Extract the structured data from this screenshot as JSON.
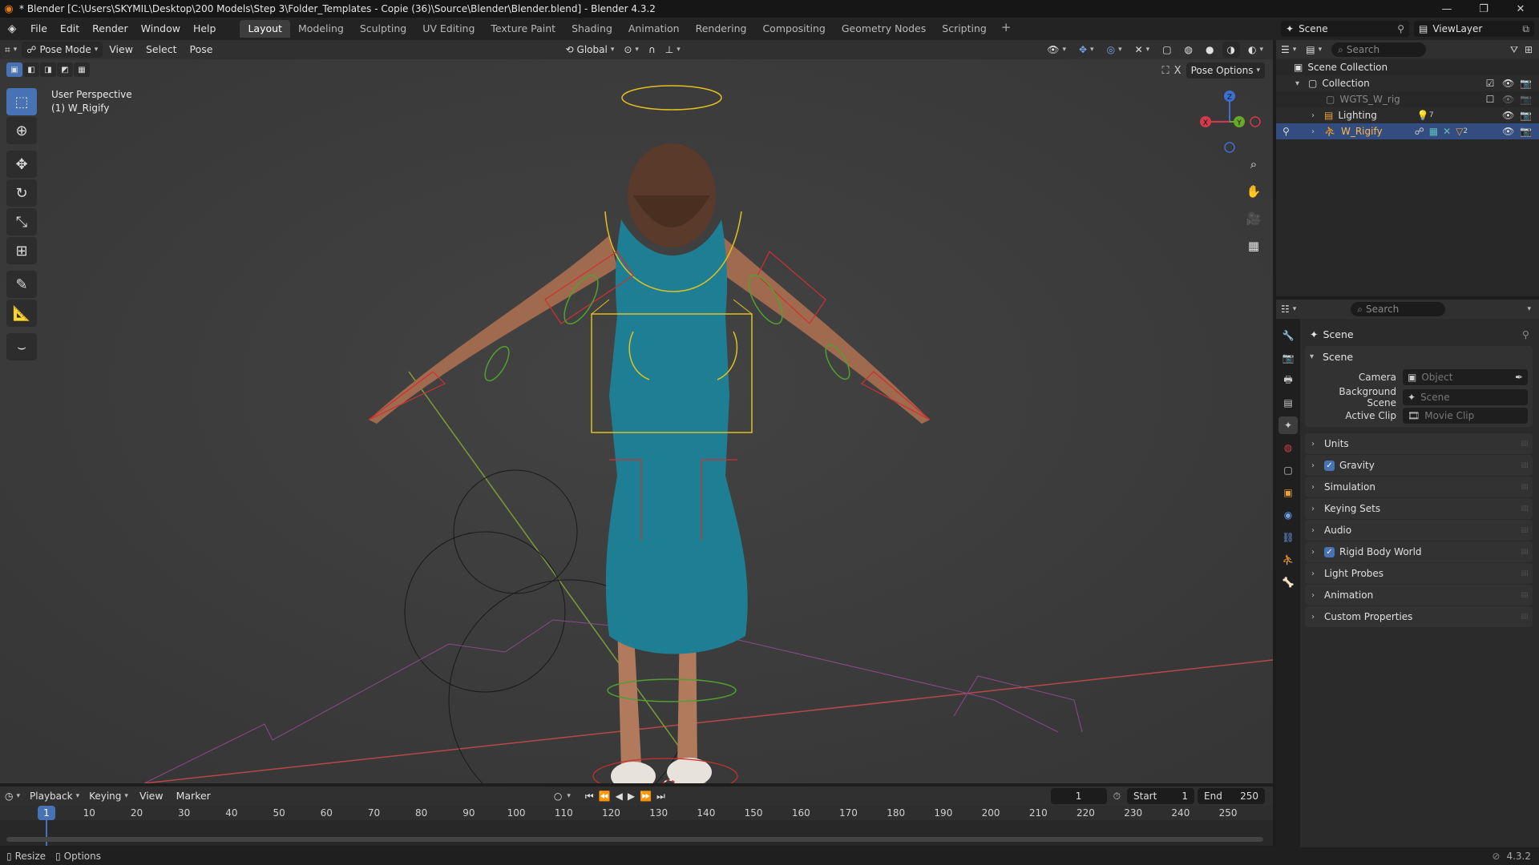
{
  "window": {
    "title": "* Blender [C:\\Users\\SKYMIL\\Desktop\\200 Models\\Step 3\\Folder_Templates - Copie (36)\\Source\\Blender\\Blender.blend] - Blender 4.3.2",
    "controls": [
      "—",
      "❐",
      "✕"
    ]
  },
  "menu": [
    "File",
    "Edit",
    "Render",
    "Window",
    "Help"
  ],
  "workspaces": [
    {
      "label": "Layout",
      "active": true
    },
    {
      "label": "Modeling",
      "active": false
    },
    {
      "label": "Sculpting",
      "active": false
    },
    {
      "label": "UV Editing",
      "active": false
    },
    {
      "label": "Texture Paint",
      "active": false
    },
    {
      "label": "Shading",
      "active": false
    },
    {
      "label": "Animation",
      "active": false
    },
    {
      "label": "Rendering",
      "active": false
    },
    {
      "label": "Compositing",
      "active": false
    },
    {
      "label": "Geometry Nodes",
      "active": false
    },
    {
      "label": "Scripting",
      "active": false
    }
  ],
  "scene_selector": {
    "scene": "Scene",
    "view_layer": "ViewLayer"
  },
  "viewport_header": {
    "mode": "Pose Mode",
    "menus": [
      "View",
      "Select",
      "Pose"
    ],
    "transform_orientation": "Global"
  },
  "viewport": {
    "info_line1": "User Perspective",
    "info_line2": "(1) W_Rigify",
    "pose_options": "Pose Options",
    "gizmo_axes": {
      "x": "X",
      "y": "Y",
      "z": "Z"
    }
  },
  "timeline": {
    "menus": [
      "Playback",
      "Keying",
      "View",
      "Marker"
    ],
    "current_frame": "1",
    "start_label": "Start",
    "start": "1",
    "end_label": "End",
    "end": "250",
    "ticks": [
      "1",
      "10",
      "20",
      "30",
      "40",
      "50",
      "60",
      "70",
      "80",
      "90",
      "100",
      "110",
      "120",
      "130",
      "140",
      "150",
      "160",
      "170",
      "180",
      "190",
      "200",
      "210",
      "220",
      "230",
      "240",
      "250"
    ]
  },
  "status": {
    "left1": "Resize",
    "left2": "Options",
    "version": "4.3.2"
  },
  "outliner": {
    "search_placeholder": "Search",
    "rows": [
      {
        "label": "Scene Collection",
        "indent": 0
      },
      {
        "label": "Collection",
        "indent": 1
      },
      {
        "label": "WGTS_W_rig",
        "indent": 2
      },
      {
        "label": "Lighting",
        "indent": 2,
        "badge": "7"
      },
      {
        "label": "W_Rigify",
        "indent": 2,
        "selected": true,
        "badge": "2"
      }
    ]
  },
  "properties": {
    "search_placeholder": "Search",
    "context_title": "Scene",
    "panel_title": "Scene",
    "fields": [
      {
        "label": "Camera",
        "placeholder": "Object"
      },
      {
        "label": "Background Scene",
        "placeholder": "Scene"
      },
      {
        "label": "Active Clip",
        "placeholder": "Movie Clip"
      }
    ],
    "subpanels": [
      {
        "label": "Units",
        "checkbox": false
      },
      {
        "label": "Gravity",
        "checkbox": true
      },
      {
        "label": "Simulation",
        "checkbox": false
      },
      {
        "label": "Keying Sets",
        "checkbox": false
      },
      {
        "label": "Audio",
        "checkbox": false
      },
      {
        "label": "Rigid Body World",
        "checkbox": true
      },
      {
        "label": "Light Probes",
        "checkbox": false
      },
      {
        "label": "Animation",
        "checkbox": false
      },
      {
        "label": "Custom Properties",
        "checkbox": false
      }
    ]
  },
  "colors": {
    "accent": "#4772b3",
    "selection": "#334d80",
    "bone_yellow": "#e0c020",
    "bone_red": "#d03030",
    "bone_green": "#50a030",
    "dress": "#1e7f94"
  }
}
